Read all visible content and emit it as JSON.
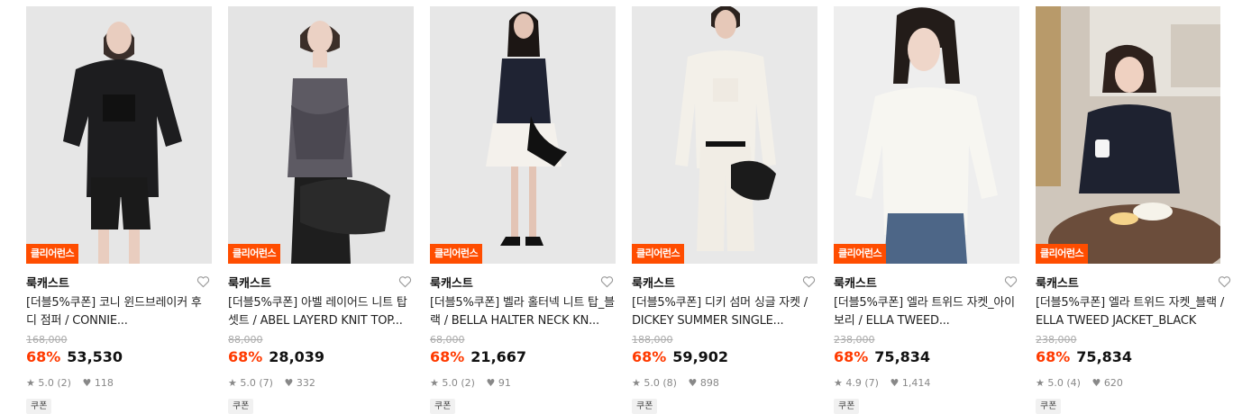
{
  "products": [
    {
      "badge": "클리어런스",
      "brand": "룩캐스트",
      "name": "[더블5%쿠폰] 코니 윈드브레이커 후디 점퍼 / CONNIE...",
      "original_price": "168,000",
      "discount": "68%",
      "price": "53,530",
      "rating": "5.0 (2)",
      "likes": "118",
      "coupon": "쿠폰",
      "photo_bg": "#e6e6e6"
    },
    {
      "badge": "클리어런스",
      "brand": "룩캐스트",
      "name": "[더블5%쿠폰] 아벨 레이어드 니트 탑 셋트 / ABEL LAYERD KNIT TOP...",
      "original_price": "88,000",
      "discount": "68%",
      "price": "28,039",
      "rating": "5.0 (7)",
      "likes": "332",
      "coupon": "쿠폰",
      "photo_bg": "#e4e4e4"
    },
    {
      "badge": "클리어런스",
      "brand": "룩캐스트",
      "name": "[더블5%쿠폰] 벨라 홀터넥 니트 탑_블랙 / BELLA HALTER NECK KN...",
      "original_price": "68,000",
      "discount": "68%",
      "price": "21,667",
      "rating": "5.0 (2)",
      "likes": "91",
      "coupon": "쿠폰",
      "photo_bg": "#e7e7e7"
    },
    {
      "badge": "클리어런스",
      "brand": "룩캐스트",
      "name": "[더블5%쿠폰] 디키 섬머 싱글 자켓 / DICKEY SUMMER SINGLE...",
      "original_price": "188,000",
      "discount": "68%",
      "price": "59,902",
      "rating": "5.0 (8)",
      "likes": "898",
      "coupon": "쿠폰",
      "photo_bg": "#e8e8e8"
    },
    {
      "badge": "클리어런스",
      "brand": "룩캐스트",
      "name": "[더블5%쿠폰] 엘라 트위드 자켓_아이보리 / ELLA TWEED...",
      "original_price": "238,000",
      "discount": "68%",
      "price": "75,834",
      "rating": "4.9 (7)",
      "likes": "1,414",
      "coupon": "쿠폰",
      "photo_bg": "#eeeeee"
    },
    {
      "badge": "클리어런스",
      "brand": "룩캐스트",
      "name": "[더블5%쿠폰] 엘라 트위드 자켓_블랙 / ELLA TWEED JACKET_BLACK",
      "original_price": "238,000",
      "discount": "68%",
      "price": "75,834",
      "rating": "5.0 (4)",
      "likes": "620",
      "coupon": "쿠폰",
      "photo_bg": "#cfc6bb"
    }
  ],
  "colors": {
    "badge": "#ff4d00",
    "discount": "#ff3a00",
    "text": "#111111",
    "muted": "#888888"
  },
  "icons": {
    "wishlist": "heart-outline-icon",
    "rating": "star-icon",
    "likes": "heart-filled-icon"
  }
}
